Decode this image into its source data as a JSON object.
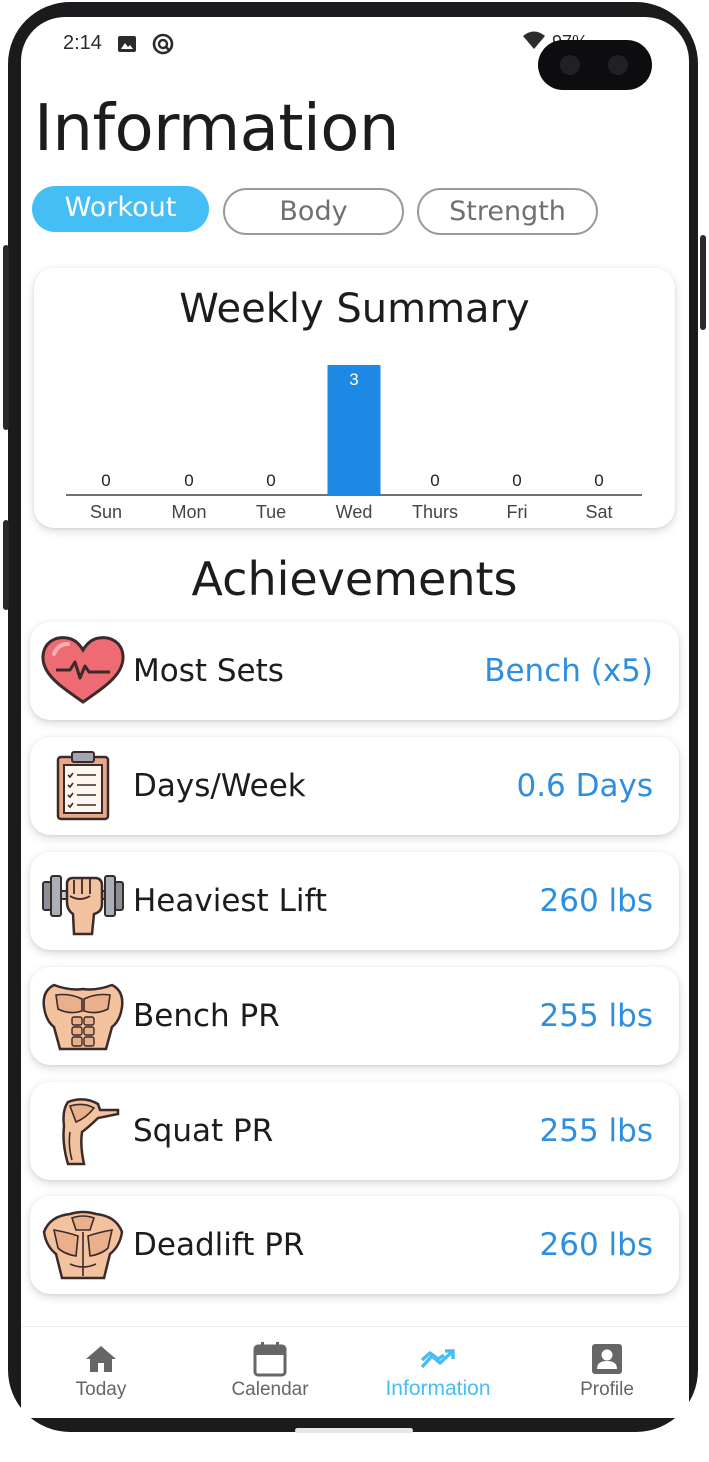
{
  "status_bar": {
    "time": "2:14",
    "battery": "97%"
  },
  "page": {
    "title": "Information"
  },
  "tabs": [
    {
      "label": "Workout",
      "active": true
    },
    {
      "label": "Body",
      "active": false
    },
    {
      "label": "Strength",
      "active": false
    }
  ],
  "weekly_summary": {
    "title": "Weekly Summary"
  },
  "chart_data": {
    "type": "bar",
    "title": "Weekly Summary",
    "categories": [
      "Sun",
      "Mon",
      "Tue",
      "Wed",
      "Thurs",
      "Fri",
      "Sat"
    ],
    "values": [
      0,
      0,
      0,
      3,
      0,
      0,
      0
    ],
    "xlabel": "",
    "ylabel": "",
    "grid": false,
    "bar_color": "#1e88e5"
  },
  "achievements": {
    "title": "Achievements",
    "items": [
      {
        "label": "Most Sets",
        "value": "Bench (x5)",
        "icon": "heart-icon"
      },
      {
        "label": "Days/Week",
        "value": "0.6 Days",
        "icon": "clipboard-icon"
      },
      {
        "label": "Heaviest Lift",
        "value": "260 lbs",
        "icon": "dumbbell-fist-icon"
      },
      {
        "label": "Bench PR",
        "value": "255 lbs",
        "icon": "chest-muscles-icon"
      },
      {
        "label": "Squat PR",
        "value": "255 lbs",
        "icon": "leg-muscle-icon"
      },
      {
        "label": "Deadlift PR",
        "value": "260 lbs",
        "icon": "back-muscles-icon"
      }
    ]
  },
  "nav": {
    "items": [
      {
        "label": "Today",
        "icon": "home-icon",
        "active": false
      },
      {
        "label": "Calendar",
        "icon": "calendar-icon",
        "active": false
      },
      {
        "label": "Information",
        "icon": "trending-icon",
        "active": true
      },
      {
        "label": "Profile",
        "icon": "profile-icon",
        "active": false
      }
    ]
  },
  "colors": {
    "accent": "#45bef6",
    "value_text": "#2e8fe0",
    "bar": "#1e88e5",
    "frame": "#1b1b1d"
  }
}
